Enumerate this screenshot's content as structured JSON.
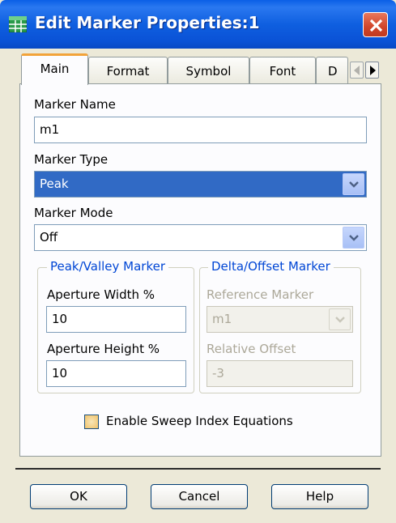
{
  "window": {
    "title": "Edit Marker Properties:1"
  },
  "tabs": [
    "Main",
    "Format",
    "Symbol",
    "Font",
    "D"
  ],
  "main": {
    "marker_name": {
      "label": "Marker Name",
      "value": "m1"
    },
    "marker_type": {
      "label": "Marker Type",
      "value": "Peak"
    },
    "marker_mode": {
      "label": "Marker Mode",
      "value": "Off"
    },
    "peak_valley": {
      "title": "Peak/Valley Marker",
      "aperture_width": {
        "label": "Aperture Width %",
        "value": "10"
      },
      "aperture_height": {
        "label": "Aperture Height %",
        "value": "10"
      }
    },
    "delta_offset": {
      "title": "Delta/Offset Marker",
      "reference_marker": {
        "label": "Reference Marker",
        "value": "m1"
      },
      "relative_offset": {
        "label": "Relative Offset",
        "value": "-3"
      }
    },
    "sweep_checkbox": {
      "label": "Enable Sweep Index Equations",
      "checked": false
    }
  },
  "buttons": {
    "ok": "OK",
    "cancel": "Cancel",
    "help": "Help"
  },
  "colors": {
    "titlebar": "#0a5fe6",
    "selection": "#316ac5",
    "group_title": "#0046d5",
    "active_tab_accent": "#f2a33a"
  }
}
